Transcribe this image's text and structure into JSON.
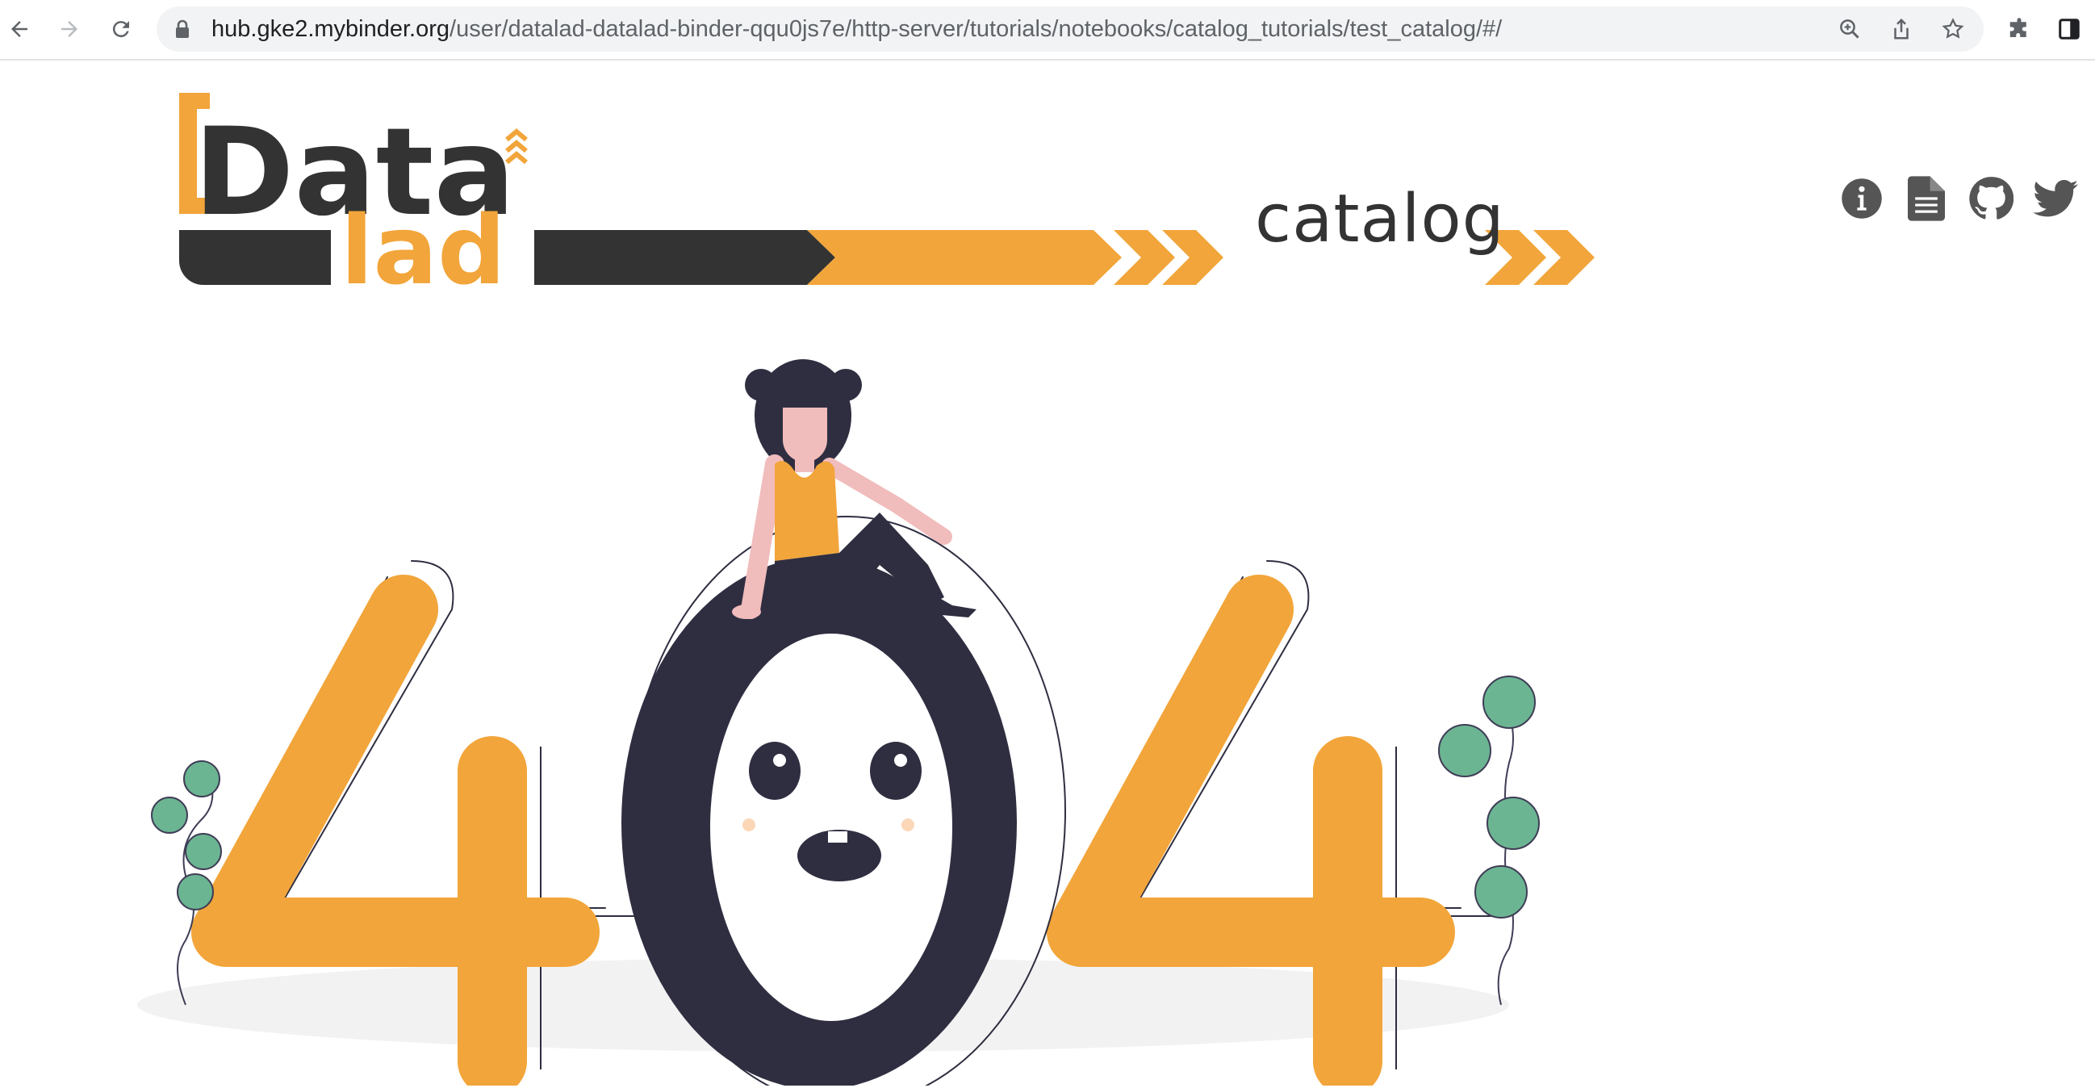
{
  "browser": {
    "url_host": "hub.gke2.mybinder.org",
    "url_path": "/user/datalad-datalad-binder-qqu0js7e/http-server/tutorials/notebooks/catalog_tutorials/test_catalog/#/",
    "icons": {
      "back": "back-arrow-icon",
      "forward": "forward-arrow-icon",
      "reload": "reload-icon",
      "lock": "lock-icon",
      "zoom": "zoom-icon",
      "share": "share-icon",
      "bookmark": "star-icon",
      "extensions": "puzzle-icon",
      "sidepanel": "side-panel-icon"
    }
  },
  "header": {
    "logo_data": "Data",
    "logo_lad": "lad",
    "logo_catalog": "catalog",
    "social": [
      "info-icon",
      "document-icon",
      "github-icon",
      "twitter-icon"
    ]
  },
  "colors": {
    "orange": "#f2a53a",
    "dark": "#2f2e41",
    "logo_dark": "#333333",
    "leaf": "#6cb593",
    "ground": "#f2f2f2",
    "skin": "#f1bcbc"
  },
  "illustration": {
    "error_code": "404"
  }
}
